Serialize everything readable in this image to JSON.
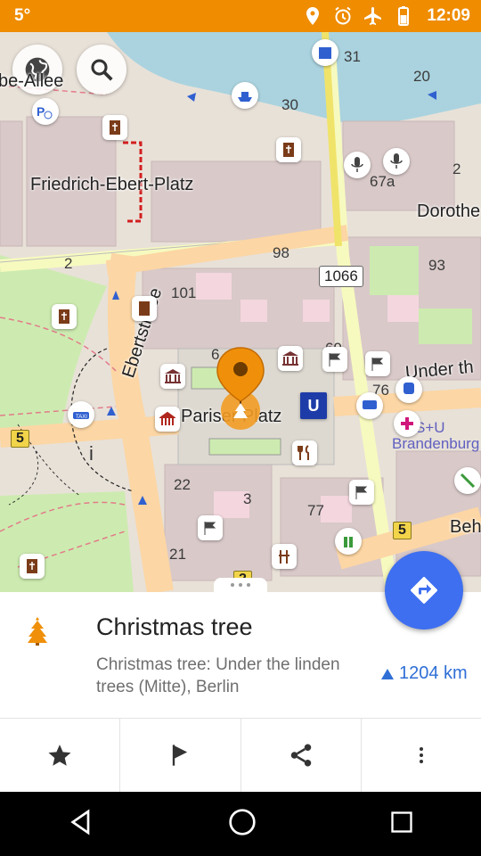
{
  "status_bar": {
    "temperature": "5°",
    "time": "12:09",
    "icons": [
      "location-icon",
      "alarm-icon",
      "airplane-mode-icon",
      "battery-icon"
    ]
  },
  "map": {
    "street_labels": {
      "allee": "be-Allee",
      "friedrich_ebert_platz": "Friedrich-Ebert-Platz",
      "dorotheen": "Dorothe",
      "ebertstrasse": "Ebertstraße",
      "pariser_platz": "Pariser Platz",
      "under_the": "Under th",
      "beh": "Beh",
      "s_u": "S+U",
      "brandenburg": "Brandenburg"
    },
    "house_numbers": {
      "n31": "31",
      "n20": "20",
      "n30": "30",
      "n2a": "2",
      "n67a": "67a",
      "n2b": "2",
      "n98": "98",
      "n93": "93",
      "n101": "101",
      "n69": "69",
      "n6": "6",
      "n76": "76",
      "n22": "22",
      "n3": "3",
      "n77": "77",
      "n21": "21"
    },
    "road_refs": {
      "r1066": "1066",
      "r5_left": "5",
      "r5_right": "5",
      "r2_bottom": "2"
    },
    "marker_icon": "christmas-tree-icon",
    "colors": {
      "accent_orange": "#ef8c00",
      "route_blue": "#3e6ff0",
      "water": "#aad3df",
      "park": "#cdebb0",
      "primary_road": "#fcd6a4",
      "secondary_road": "#f7fabf"
    }
  },
  "poi": {
    "title": "Christmas tree",
    "description": "Christmas tree: Under the linden trees (Mitte), Berlin",
    "distance": "1204 km",
    "icon": "christmas-tree-icon"
  },
  "actions": [
    {
      "name": "favorite",
      "icon": "star-icon"
    },
    {
      "name": "add-marker",
      "icon": "flag-icon"
    },
    {
      "name": "share",
      "icon": "share-icon"
    },
    {
      "name": "more",
      "icon": "more-vertical-icon"
    }
  ],
  "nav_bar": {
    "icons": [
      "back-icon",
      "home-icon",
      "recents-icon"
    ]
  }
}
